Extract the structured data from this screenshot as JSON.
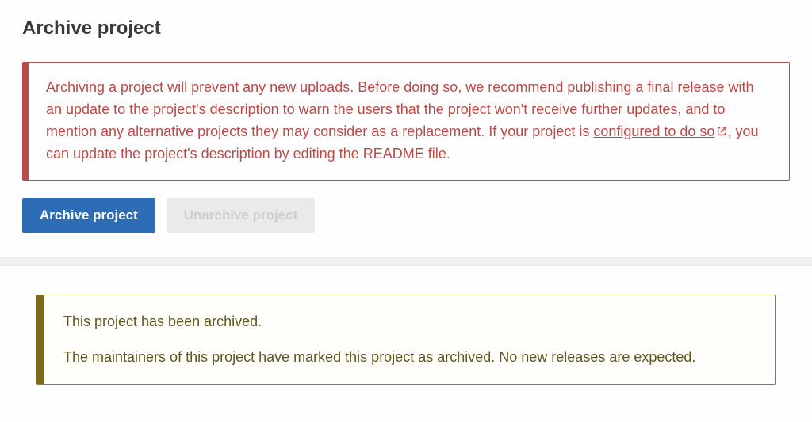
{
  "section": {
    "title": "Archive project"
  },
  "warning": {
    "text_before_link": "Archiving a project will prevent any new uploads. Before doing so, we recommend publishing a final release with an update to the project's description to warn the users that the project won't receive further updates, and to mention any alternative projects they may consider as a replacement. If your project is ",
    "link_text": "configured to do so",
    "text_after_link": ", you can update the project's description by editing the README file."
  },
  "buttons": {
    "archive": "Archive project",
    "unarchive": "Unarchive project"
  },
  "archived_notice": {
    "line1": "This project has been archived.",
    "line2": "The maintainers of this project have marked this project as archived. No new releases are expected."
  }
}
